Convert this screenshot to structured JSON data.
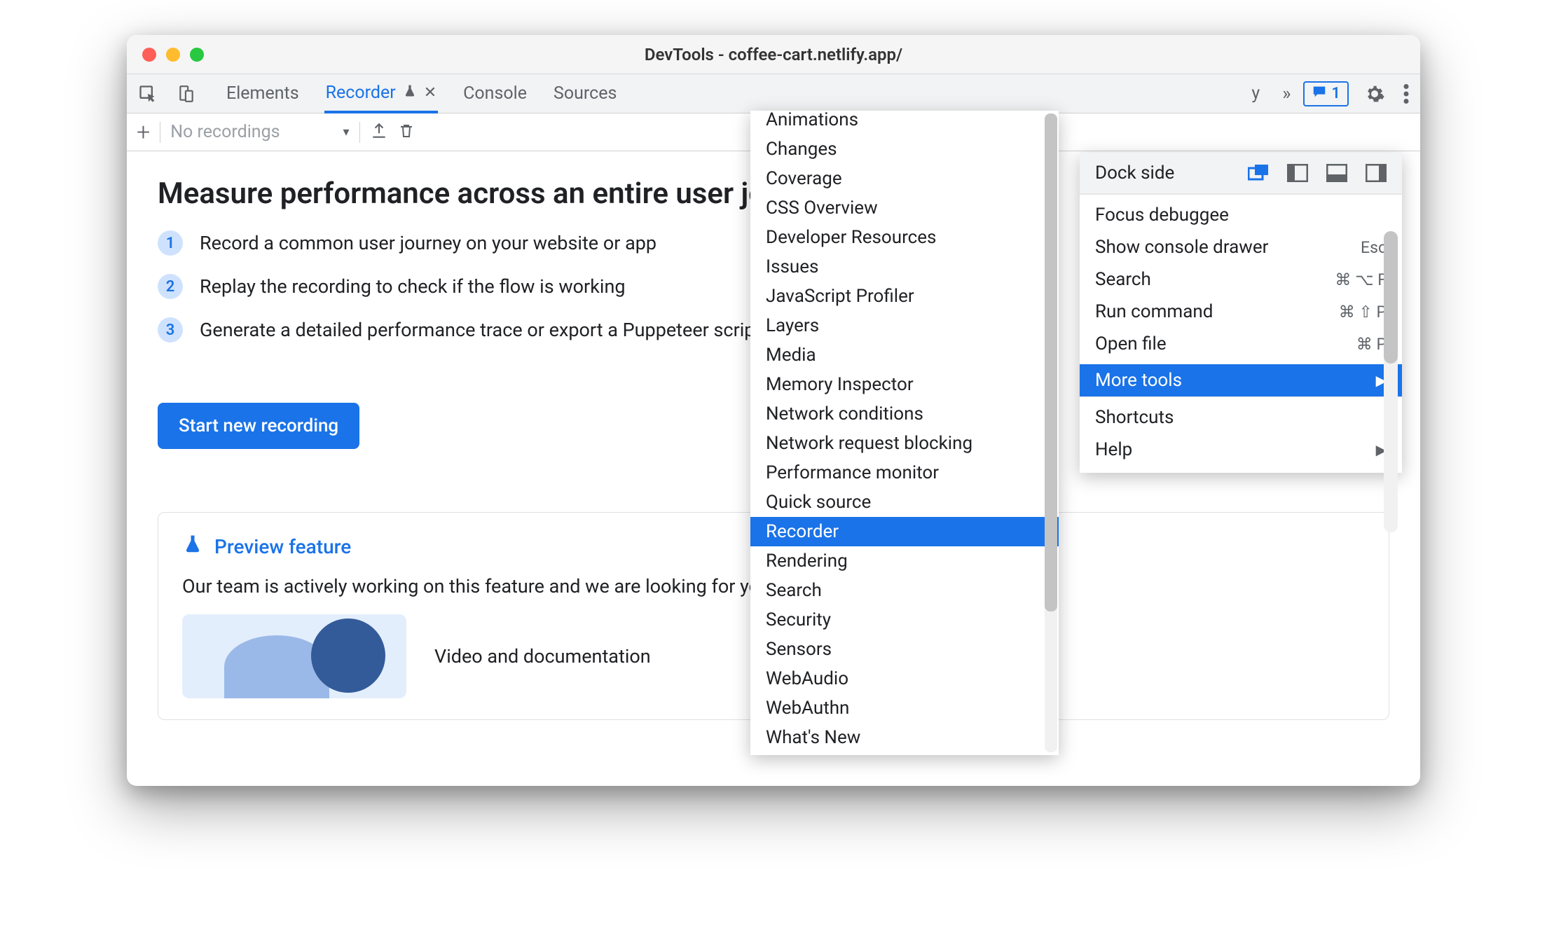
{
  "window": {
    "title": "DevTools - coffee-cart.netlify.app/"
  },
  "tabs": {
    "elements": "Elements",
    "recorder": "Recorder",
    "console": "Console",
    "sources": "Sources",
    "overflow_hint": "y",
    "chevrons": "»",
    "issue_count": "1"
  },
  "toolbar": {
    "dropdown_placeholder": "No recordings"
  },
  "recorder_panel": {
    "heading": "Measure performance across an entire user journey",
    "step1": "Record a common user journey on your website or app",
    "step2": "Replay the recording to check if the flow is working",
    "step3": "Generate a detailed performance trace or export a Puppeteer script",
    "start_button": "Start new recording",
    "preview_title": "Preview feature",
    "preview_body": "Our team is actively working on this feature and we are looking for your feedback!",
    "video_label": "Video and documentation"
  },
  "more_tools": {
    "items": [
      "Animations",
      "Changes",
      "Coverage",
      "CSS Overview",
      "Developer Resources",
      "Issues",
      "JavaScript Profiler",
      "Layers",
      "Media",
      "Memory Inspector",
      "Network conditions",
      "Network request blocking",
      "Performance monitor",
      "Quick source",
      "Recorder",
      "Rendering",
      "Search",
      "Security",
      "Sensors",
      "WebAudio",
      "WebAuthn",
      "What's New"
    ],
    "selected": "Recorder"
  },
  "main_menu": {
    "dock_side_label": "Dock side",
    "focus_debuggee": "Focus debuggee",
    "show_console": "Show console drawer",
    "show_console_sc": "Esc",
    "search": "Search",
    "search_sc": "⌘ ⌥ F",
    "run_command": "Run command",
    "run_command_sc": "⌘ ⇧ P",
    "open_file": "Open file",
    "open_file_sc": "⌘ P",
    "more_tools": "More tools",
    "shortcuts": "Shortcuts",
    "help": "Help"
  }
}
